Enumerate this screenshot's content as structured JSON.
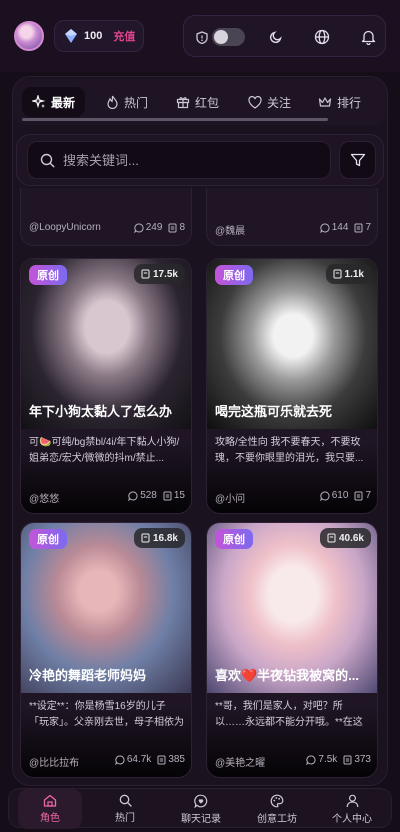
{
  "header": {
    "coins": "100",
    "recharge_label": "充值"
  },
  "tabs": [
    {
      "label": "最新",
      "icon": "sparkle-icon",
      "active": true
    },
    {
      "label": "热门",
      "icon": "flame-icon"
    },
    {
      "label": "红包",
      "icon": "gift-icon"
    },
    {
      "label": "关注",
      "icon": "heart-icon"
    },
    {
      "label": "排行",
      "icon": "crown-icon"
    }
  ],
  "search": {
    "placeholder": "搜索关键词..."
  },
  "cards": [
    {
      "author": "@LoopyUnicorn",
      "comments": "249",
      "chats": "8"
    },
    {
      "author": "@魏晨",
      "comments": "144",
      "chats": "7"
    },
    {
      "badge": "原创",
      "count": "17.5k",
      "title": "年下小狗太黏人了怎么办",
      "desc": "可🍉可纯/bg禁bl/4i/年下黏人小狗/姐弟恋/宏犬/微微的抖m/禁止...",
      "author": "@悠悠",
      "comments": "528",
      "chats": "15"
    },
    {
      "badge": "原创",
      "count": "1.1k",
      "title": "喝完这瓶可乐就去死",
      "desc": "攻略/全性向 我不要春天，不要玫瑰，不要你眼里的泪光，我只要...",
      "author": "@小问",
      "comments": "610",
      "chats": "7"
    },
    {
      "badge": "原创",
      "count": "16.8k",
      "title": "冷艳的舞蹈老师妈妈",
      "desc": "**设定**：你是杨雪16岁的儿子「玩家」。父亲刚去世，母子相依为命。...",
      "author": "@比比拉布",
      "comments": "64.7k",
      "chats": "385"
    },
    {
      "badge": "原创",
      "count": "40.6k",
      "title": "喜欢❤️半夜钻我被窝的...",
      "desc": "**哥，我们是家人，对吧？所以……永远都不能分开哦。**在这座被邻...",
      "author": "@美艳之曜",
      "comments": "7.5k",
      "chats": "373"
    }
  ],
  "bottom_nav": [
    {
      "label": "角色",
      "icon": "home-icon",
      "active": true
    },
    {
      "label": "热门",
      "icon": "search-icon"
    },
    {
      "label": "聊天记录",
      "icon": "chat-heart-icon"
    },
    {
      "label": "创意工坊",
      "icon": "palette-icon"
    },
    {
      "label": "个人中心",
      "icon": "user-icon"
    }
  ],
  "colors": {
    "accent": "#e0448f",
    "badge_gradient_start": "#c454d8",
    "badge_gradient_end": "#7b6af0",
    "background": "#150e18"
  }
}
